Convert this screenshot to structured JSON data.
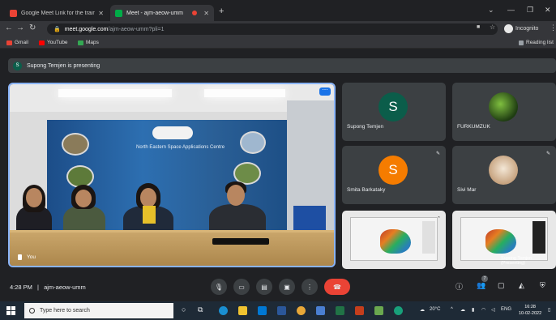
{
  "browser": {
    "tabs": [
      {
        "title": "Google Meet Link for the trainin",
        "favicon_color": "#ea4335"
      },
      {
        "title": "Meet - ajm-aeow-umm",
        "favicon_color": "#00ac47"
      }
    ],
    "url_domain": "meet.google.com",
    "url_path": "/ajm-aeow-umm?pli=1",
    "profile_label": "Incognito",
    "bookmarks": [
      {
        "label": "Gmail",
        "color": "#ea4335"
      },
      {
        "label": "YouTube",
        "color": "#ff0000"
      },
      {
        "label": "Maps",
        "color": "#34a853"
      }
    ],
    "reading_list": "Reading list"
  },
  "meet": {
    "presenter_initial": "S",
    "presenting_text": "Supong Temjen is presenting",
    "stage_name": "You",
    "banner_title": "North Eastern Space Applications Centre",
    "participants": [
      {
        "name": "Supong Temjen",
        "initial": "S",
        "avatar": "green"
      },
      {
        "name": "FURKUMZUK",
        "initial": "",
        "avatar": "leaf"
      },
      {
        "name": "Smita Barkataky",
        "initial": "S",
        "avatar": "orange"
      },
      {
        "name": "Sivi Mar",
        "initial": "",
        "avatar": "photo"
      }
    ],
    "share_tile_label": "Supong Temjen (Presenting)",
    "time": "4:28 PM",
    "meeting_code": "ajm-aeow-umm",
    "participant_count": "7"
  },
  "taskbar": {
    "search_placeholder": "Type here to search",
    "weather": "20°C",
    "language": "ENG",
    "clock_time": "16:28",
    "clock_date": "10-02-2022"
  }
}
